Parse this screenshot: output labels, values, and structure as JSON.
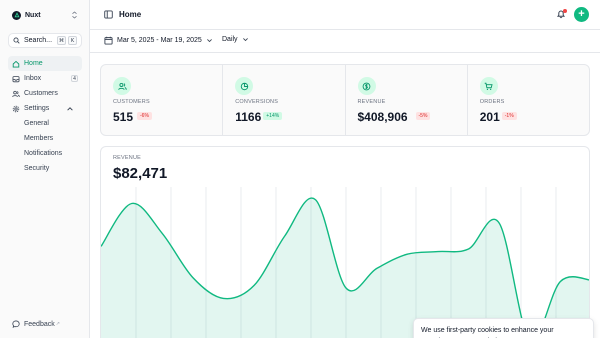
{
  "app": {
    "name": "Nuxt"
  },
  "search": {
    "label": "Search...",
    "kbd": [
      "⌘",
      "K"
    ]
  },
  "sidebar": {
    "items": [
      {
        "label": "Home",
        "active": true
      },
      {
        "label": "Inbox",
        "badge": "4"
      },
      {
        "label": "Customers"
      },
      {
        "label": "Settings",
        "expanded": true
      }
    ],
    "settings_children": [
      "General",
      "Members",
      "Notifications",
      "Security"
    ],
    "feedback": "Feedback"
  },
  "header": {
    "title": "Home"
  },
  "toolbar": {
    "date_range": "Mar 5, 2025 - Mar 19, 2025",
    "period": "Daily"
  },
  "stats": [
    {
      "label": "CUSTOMERS",
      "value": "515",
      "change": "-6%",
      "trend": "neg",
      "icon": "users-icon"
    },
    {
      "label": "CONVERSIONS",
      "value": "1166",
      "change": "+14%",
      "trend": "pos",
      "icon": "pie-chart-icon"
    },
    {
      "label": "REVENUE",
      "value": "$408,906",
      "change": "-5%",
      "trend": "neg",
      "icon": "dollar-icon"
    },
    {
      "label": "ORDERS",
      "value": "201",
      "change": "-1%",
      "trend": "neg",
      "icon": "cart-icon"
    }
  ],
  "revenue": {
    "label": "REVENUE",
    "value": "$82,471"
  },
  "chart_data": {
    "type": "area",
    "title": "",
    "xlabel": "",
    "ylabel": "",
    "values": [
      62,
      95,
      72,
      38,
      22,
      32,
      70,
      98,
      30,
      45,
      56,
      58,
      60,
      80,
      -10,
      35,
      36
    ],
    "grid": true,
    "accent": "#10b981"
  },
  "cookie": {
    "text": "We use first-party cookies to enhance your experience on our website."
  },
  "colors": {
    "accent": "#10b981",
    "active_text": "#059669",
    "negative": "#dc2626"
  }
}
